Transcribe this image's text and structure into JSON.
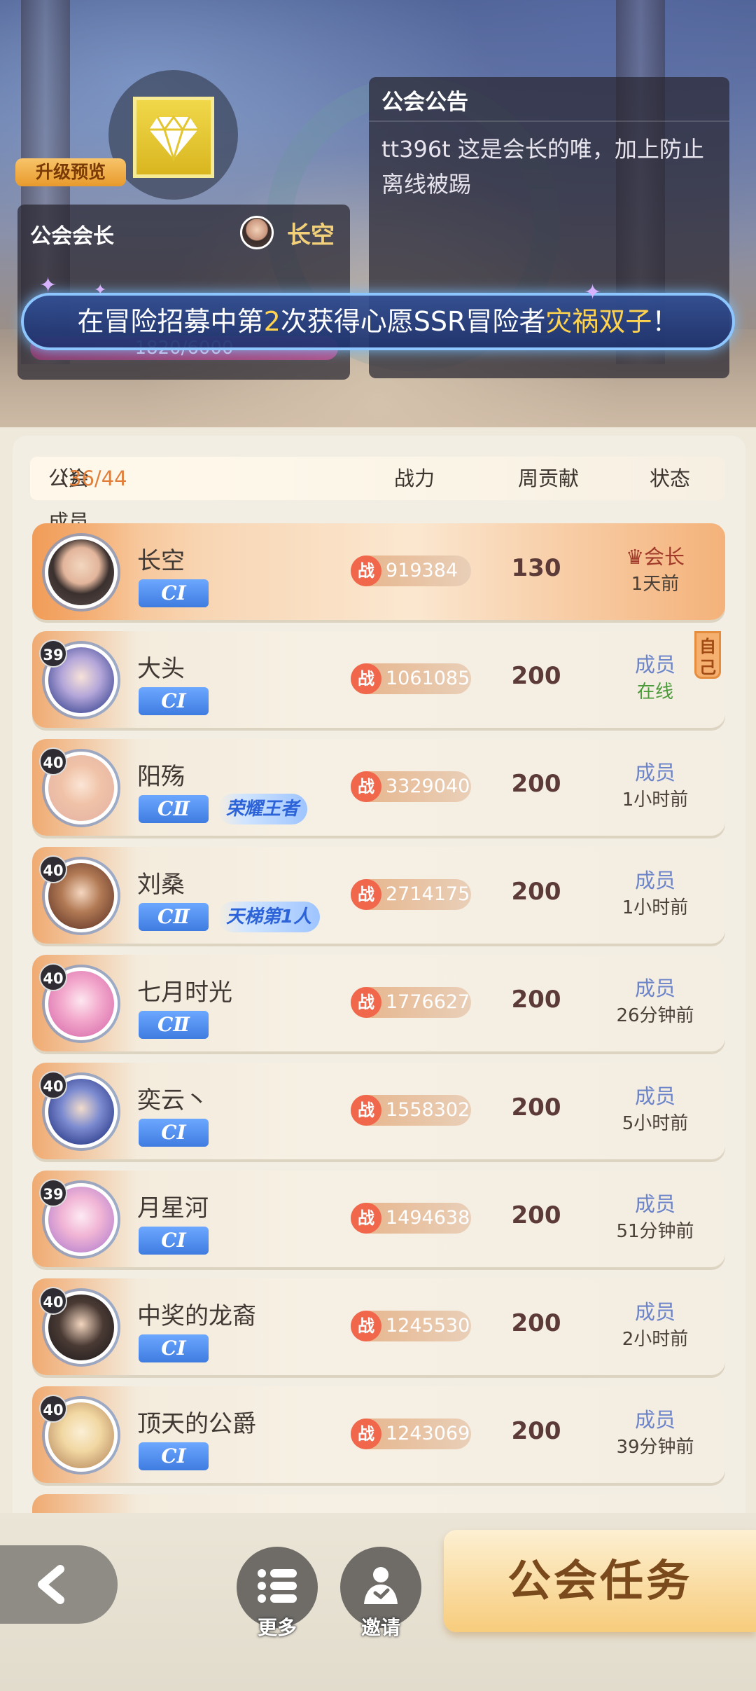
{
  "header": {
    "upgrade_label": "升级预览",
    "leader_panel_title": "公会会长",
    "leader_name": "长空",
    "progress_text": "1820/6000",
    "notice_title": "公会公告",
    "notice_text": "tt396t 这是会长的唯，加上防止离线被踢",
    "broadcast": {
      "before": "在冒险招募中第",
      "number": "2",
      "middle": "次获得心愿SSR冒险者",
      "highlight": "灾祸双子",
      "end": "！"
    }
  },
  "list_header": {
    "members_label": "公会成员",
    "members_count": "36/44",
    "power_label": "战力",
    "weekly_label": "周贡献",
    "status_label": "状态"
  },
  "power_icon_text": "战",
  "self_tag": "自己",
  "members": [
    {
      "name": "长空",
      "level": "",
      "rank": "CⅠ",
      "title": "",
      "power": "919384",
      "weekly": "130",
      "role": "会长",
      "time": "1天前"
    },
    {
      "name": "大头",
      "level": "39",
      "rank": "CⅠ",
      "title": "",
      "power": "1061085",
      "weekly": "200",
      "role": "成员",
      "time": "在线"
    },
    {
      "name": "阳殇",
      "level": "40",
      "rank": "CⅡ",
      "title": "荣耀王者",
      "power": "3329040",
      "weekly": "200",
      "role": "成员",
      "time": "1小时前"
    },
    {
      "name": "刘桑",
      "level": "40",
      "rank": "CⅡ",
      "title": "天梯第1人",
      "power": "2714175",
      "weekly": "200",
      "role": "成员",
      "time": "1小时前"
    },
    {
      "name": "七月时光",
      "level": "40",
      "rank": "CⅡ",
      "title": "",
      "power": "1776627",
      "weekly": "200",
      "role": "成员",
      "time": "26分钟前"
    },
    {
      "name": "奕云丶",
      "level": "40",
      "rank": "CⅠ",
      "title": "",
      "power": "1558302",
      "weekly": "200",
      "role": "成员",
      "time": "5小时前"
    },
    {
      "name": "月星河",
      "level": "39",
      "rank": "CⅠ",
      "title": "",
      "power": "1494638",
      "weekly": "200",
      "role": "成员",
      "time": "51分钟前"
    },
    {
      "name": "中奖的龙裔",
      "level": "40",
      "rank": "CⅠ",
      "title": "",
      "power": "1245530",
      "weekly": "200",
      "role": "成员",
      "time": "2小时前"
    },
    {
      "name": "顶天的公爵",
      "level": "40",
      "rank": "CⅠ",
      "title": "",
      "power": "1243069",
      "weekly": "200",
      "role": "成员",
      "time": "39分钟前"
    }
  ],
  "bottom": {
    "more_label": "更多",
    "invite_label": "邀请",
    "task_label": "公会任务"
  },
  "icons": [
    "diamond-icon",
    "crown-icon",
    "back-arrow-icon",
    "list-icon",
    "invite-icon",
    "power-icon"
  ]
}
